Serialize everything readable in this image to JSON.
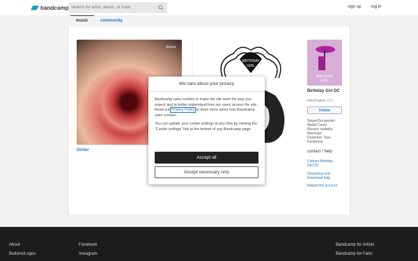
{
  "header": {
    "logo_text": "bandcamp",
    "search_placeholder": "Search for artist, album, or track",
    "signup_label": "sign up",
    "login_label": "log in"
  },
  "tabs": [
    {
      "label": "music"
    },
    {
      "label": "community"
    }
  ],
  "albums": [
    {
      "title": "Dirtier",
      "cover_text": "dirtier"
    },
    {
      "title": ""
    }
  ],
  "artist": {
    "name": "Birthday Girl DC",
    "location": "Washington, D.C.",
    "follow_label": "Follow",
    "bio_lines": [
      "Singer/Songwriter:",
      "Mabel Canty",
      "Bassist: Isabella",
      "MacKaye",
      "Drummer: Tess",
      "Kontarinis"
    ],
    "contact_heading": "contact / help",
    "links": [
      {
        "label_line1": "Contact Birthday",
        "label_line2": "Girl DC"
      },
      {
        "label_line1": "Streaming and",
        "label_line2": "Download help"
      },
      {
        "label_line1": "Report this account",
        "label_line2": ""
      }
    ]
  },
  "modal": {
    "title": "We care about your privacy",
    "para1_before": "Bandcamp uses cookies to make the site work the way you expect and to better understand how our users access the site. Read our ",
    "privacy_link": "Privacy Policy",
    "para1_after": " to learn more about how Bandcamp uses cookies.",
    "para2": "You can update your cookie settings at any time by clicking the “Cookie settings” link at the bottom of any Bandcamp page.",
    "accept_all_label": "Accept all",
    "accept_necessary_label": "Accept necessary only"
  },
  "footer": {
    "col1": [
      "About",
      "Buttons/Logos"
    ],
    "col2": [
      "Facebook",
      "Instagram"
    ],
    "col3": [
      "Bandcamp for Artists",
      "Bandcamp for Fans"
    ]
  },
  "colors": {
    "accent_blue": "#1a73c1",
    "logo_blue": "#1da0c3",
    "footer_bg": "#1c1c1c"
  }
}
